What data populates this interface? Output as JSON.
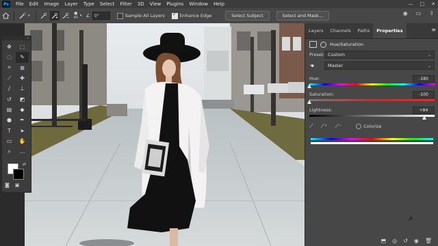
{
  "menubar": {
    "logo": "Ps",
    "items": [
      "File",
      "Edit",
      "Image",
      "Layer",
      "Type",
      "Select",
      "Filter",
      "3D",
      "View",
      "Plugins",
      "Window",
      "Help"
    ],
    "window_controls": [
      "—",
      "□",
      "✕"
    ]
  },
  "options": {
    "brush_size": "40",
    "angle": "0°",
    "sample_all_layers": "Sample All Layers",
    "enhance_edge": "Enhance Edge",
    "select_subject": "Select Subject",
    "select_and_mask": "Select and Mask..."
  },
  "panel": {
    "tabs": [
      "Layers",
      "Channels",
      "Paths",
      "Properties"
    ],
    "active_tab": "Properties",
    "header": "Hue/Saturation",
    "preset_label": "Preset:",
    "preset_value": "Custom",
    "channel_value": "Master",
    "hue_label": "Hue:",
    "hue_value": "-180",
    "sat_label": "Saturation:",
    "sat_value": "-100",
    "light_label": "Lightness:",
    "light_value": "+84",
    "colorize_label": "Colorize"
  },
  "adjustments": {
    "hue": -180,
    "saturation": -100,
    "lightness": 84
  },
  "colors": {
    "accent": "#31a8ff",
    "foreground": "#ffffff",
    "background": "#000000"
  }
}
